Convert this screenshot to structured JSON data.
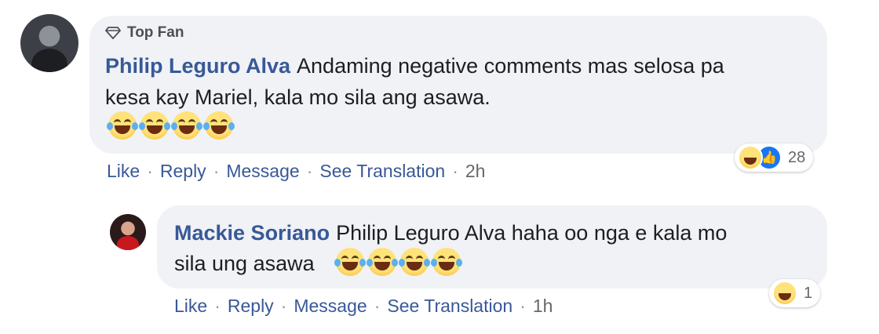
{
  "comment": {
    "badge_label": "Top Fan",
    "author": "Philip Leguro Alva",
    "text_line1": "Andaming negative comments mas selosa pa",
    "text_line2": "kesa kay Mariel, kala mo sila ang asawa.",
    "emoji_count": 4,
    "reaction_count": "28",
    "reactions": [
      "haha",
      "like"
    ],
    "actions": {
      "like": "Like",
      "reply": "Reply",
      "message": "Message",
      "see_translation": "See Translation",
      "time": "2h"
    }
  },
  "reply": {
    "author": "Mackie Soriano",
    "text_line1": "Philip Leguro Alva haha oo nga e kala mo",
    "text_line2": "sila ung asawa",
    "emoji_count": 4,
    "reaction_count": "1",
    "reactions": [
      "haha"
    ],
    "actions": {
      "like": "Like",
      "reply": "Reply",
      "message": "Message",
      "see_translation": "See Translation",
      "time": "1h"
    }
  },
  "colors": {
    "author": "#385898",
    "bubble": "#f0f2f5",
    "text": "#1c1e21",
    "meta": "#65676b"
  }
}
